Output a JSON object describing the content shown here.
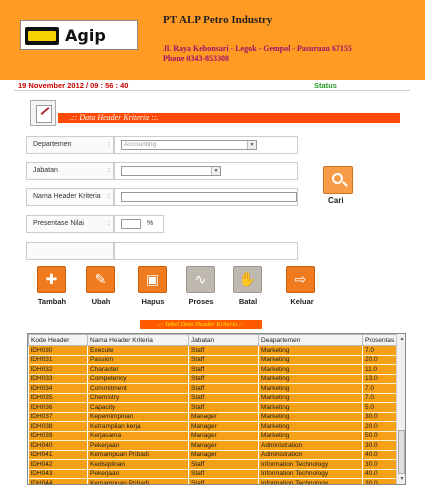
{
  "header": {
    "logo_text": "Agip",
    "company_name": "PT ALP Petro Industry",
    "address_line1": "Jl. Raya Kebonsari - Legok - Gempol - Pasuruan 67155",
    "address_line2": "Phone 0343-853308"
  },
  "status_bar": {
    "datetime": "19 November 2012 / 09 : 56 : 40",
    "status_label": "Status"
  },
  "form": {
    "title": ".:: Data Header Kriteria ::.",
    "departemen_label": "Departemen",
    "departemen_value": "Accounting",
    "jabatan_label": "Jabatan",
    "jabatan_value": "",
    "nama_header_label": "Nama Header Kriteria",
    "presentase_label": "Presentase Nilai",
    "percent_sign": "%",
    "colon": ":"
  },
  "search": {
    "label": "Cari"
  },
  "actions": {
    "tambah": "Tambah",
    "ubah": "Ubah",
    "hapus": "Hapus",
    "proses": "Proses",
    "batal": "Batal",
    "keluar": "Keluar"
  },
  "table": {
    "title": ".:: Tabel Data Header Kriteria ::.",
    "columns": [
      "Kode Header",
      "Nama Header Kriteria",
      "Jabatan",
      "Deapartemen",
      "Prosentas"
    ],
    "rows": [
      [
        "IDH030",
        "Execute",
        "Staff",
        "Marketing",
        "7.0"
      ],
      [
        "IDH031",
        "Passion",
        "Staff",
        "Marketing",
        "20.0"
      ],
      [
        "IDH032",
        "Character",
        "Staff",
        "Marketing",
        "11.0"
      ],
      [
        "IDH033",
        "Competency",
        "Staff",
        "Marketing",
        "13.0"
      ],
      [
        "IDH034",
        "Commitment",
        "Staff",
        "Marketing",
        "7.0"
      ],
      [
        "IDH035",
        "Chemistry",
        "Staff",
        "Marketing",
        "7.0"
      ],
      [
        "IDH036",
        "Capacity",
        "Staff",
        "Marketing",
        "5.0"
      ],
      [
        "IDH037",
        "Kepemimpinan",
        "Manager",
        "Marketing",
        "30.0"
      ],
      [
        "IDH038",
        "Ketrampilan kerja",
        "Manager",
        "Marketing",
        "20.0"
      ],
      [
        "IDH039",
        "Kerjasama",
        "Manager",
        "Marketing",
        "50.0"
      ],
      [
        "IDH040",
        "Pekerjaan",
        "Manager",
        "Administration",
        "30.0"
      ],
      [
        "IDH041",
        "Kemampuan Pribadi",
        "Manager",
        "Administration",
        "40.0"
      ],
      [
        "IDH042",
        "Kedisiplinan",
        "Staff",
        "Information Technology",
        "30.0"
      ],
      [
        "IDH043",
        "Pekerjaan",
        "Staff",
        "Information Technology",
        "40.0"
      ],
      [
        "IDH044",
        "Kemampuan Pribadi",
        "Staff",
        "Information Technology",
        "30.0"
      ]
    ]
  },
  "colors": {
    "header_orange": "#ff9a22",
    "title_bar": "#ff4800",
    "row_fill": "#f5a016",
    "button_orange": "#f07a1e",
    "button_disabled": "#bfb8b0",
    "datetime_red": "#cc0000",
    "status_green": "#2a9a2a"
  },
  "icons": {
    "tambah": "plus-icon",
    "ubah": "pencil-icon",
    "hapus": "basket-icon",
    "proses": "process-icon",
    "batal": "hand-icon",
    "keluar": "exit-icon",
    "search": "magnifier-icon"
  }
}
